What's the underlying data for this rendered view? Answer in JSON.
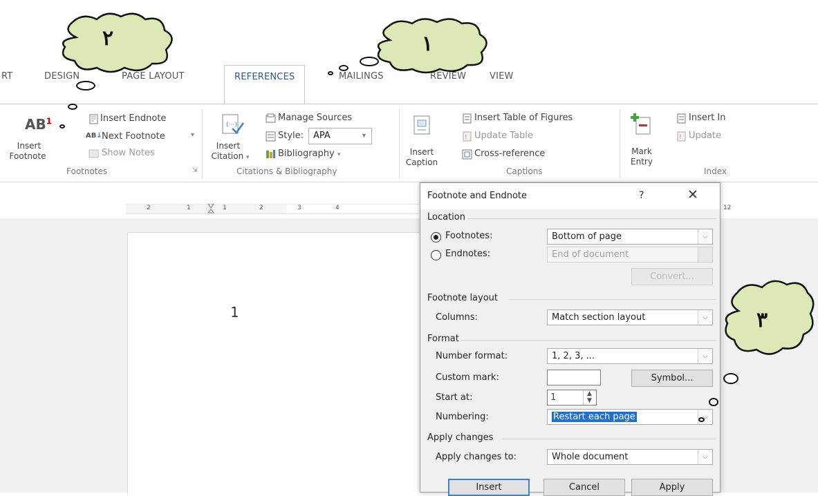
{
  "tabs": [
    {
      "label": "RT"
    },
    {
      "label": "DESIGN"
    },
    {
      "label": "PAGE LAYOUT"
    },
    {
      "label": "REFERENCES",
      "active": true
    },
    {
      "label": "MAILINGS"
    },
    {
      "label": "REVIEW"
    },
    {
      "label": "VIEW"
    }
  ],
  "ribbon": {
    "footnotes": {
      "insert_footnote": "Insert\nFootnote",
      "insert_footnote_top": "Insert",
      "insert_footnote_bottom": "Footnote",
      "insert_endnote": "Insert Endnote",
      "next_footnote": "Next Footnote",
      "show_notes": "Show Notes",
      "group": "Footnotes",
      "icon_text": "AB",
      "icon_sup": "1"
    },
    "citations": {
      "insert_citation_top": "Insert",
      "insert_citation_bottom": "Citation",
      "manage_sources": "Manage Sources",
      "style_label": "Style:",
      "style_value": "APA",
      "bibliography": "Bibliography",
      "group": "Citations & Bibliography"
    },
    "captions": {
      "insert_caption_top": "Insert",
      "insert_caption_bottom": "Caption",
      "insert_table_of_figures": "Insert Table of Figures",
      "update_table": "Update Table",
      "cross_reference": "Cross-reference",
      "group": "Captions"
    },
    "index": {
      "mark_entry_top": "Mark",
      "mark_entry_bottom": "Entry",
      "insert_index": "Insert In",
      "update_index": "Update",
      "group": "Index"
    }
  },
  "ruler": {
    "numbers": [
      "2",
      "1",
      "1",
      "2",
      "3",
      "4",
      "12"
    ]
  },
  "document": {
    "text": "1"
  },
  "dialog": {
    "title": "Footnote and Endnote",
    "help": "?",
    "close": "✕",
    "location": {
      "section": "Location",
      "footnotes_label": "Footnotes:",
      "footnotes_value": "Bottom of page",
      "endnotes_label": "Endnotes:",
      "endnotes_value": "End of document",
      "convert_button": "Convert..."
    },
    "layout": {
      "section": "Footnote layout",
      "columns_label": "Columns:",
      "columns_value": "Match section layout"
    },
    "format": {
      "section": "Format",
      "number_format_label": "Number format:",
      "number_format_value": "1, 2, 3, ...",
      "custom_mark_label": "Custom mark:",
      "custom_mark_value": "",
      "symbol_button": "Symbol...",
      "start_at_label": "Start at:",
      "start_at_value": "1",
      "numbering_label": "Numbering:",
      "numbering_value": "Restart each page"
    },
    "apply": {
      "section": "Apply changes",
      "apply_to_label": "Apply changes to:",
      "apply_to_value": "Whole document"
    },
    "buttons": {
      "insert": "Insert",
      "cancel": "Cancel",
      "apply": "Apply"
    }
  },
  "callouts": {
    "one": "١",
    "two": "٢",
    "three": "٣"
  },
  "colors": {
    "cloud_fill": "#dce8b6",
    "accent": "#2b579a",
    "selection": "#1f6fd1"
  }
}
